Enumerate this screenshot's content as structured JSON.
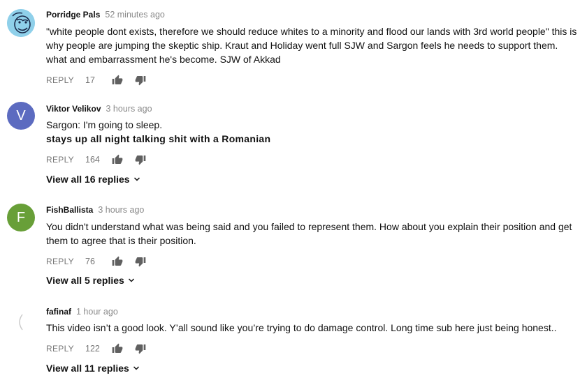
{
  "comments": [
    {
      "author": "Porridge Pals",
      "time": "52 minutes ago",
      "lines": [
        "\"white people dont exists, therefore we should reduce whites to a minority and flood our lands with 3rd world people\"  this is",
        "why people are jumping the skeptic ship.  Kraut and Holiday went full SJW and Sargon feels he needs to support them.",
        "what and embarrassment he's become.  SJW of Akkad"
      ],
      "reply_label": "REPLY",
      "likes": "17"
    },
    {
      "author": "Viktor Velikov",
      "time": "3 hours ago",
      "avatar_letter": "V",
      "line1": "Sargon: I'm going to sleep.",
      "line2_bold": "stays up all night talking shit with a Romanian",
      "reply_label": "REPLY",
      "likes": "164",
      "view_replies": "View all 16 replies"
    },
    {
      "author": "FishBallista",
      "time": "3 hours ago",
      "avatar_letter": "F",
      "lines": [
        "You didn't understand what was being said and you failed to represent them. How about you explain their position and get",
        "them to agree that is their position."
      ],
      "reply_label": "REPLY",
      "likes": "76",
      "view_replies": "View all 5 replies"
    },
    {
      "author": "fafinaf",
      "time": "1 hour ago",
      "lines": [
        "This video isn’t a good look. Y’all sound like you’re trying to do damage control. Long time sub here just being honest.."
      ],
      "reply_label": "REPLY",
      "likes": "122",
      "view_replies": "View all 11 replies"
    }
  ],
  "colors": {
    "avatar_v": "#5c6bc0",
    "avatar_f": "#689f38",
    "avatar_porridge": "#8fd0ea",
    "muted": "#767676",
    "text": "#111111"
  },
  "icons": {
    "like": "thumbs-up-icon",
    "dislike": "thumbs-down-icon",
    "expand": "chevron-down-icon"
  }
}
